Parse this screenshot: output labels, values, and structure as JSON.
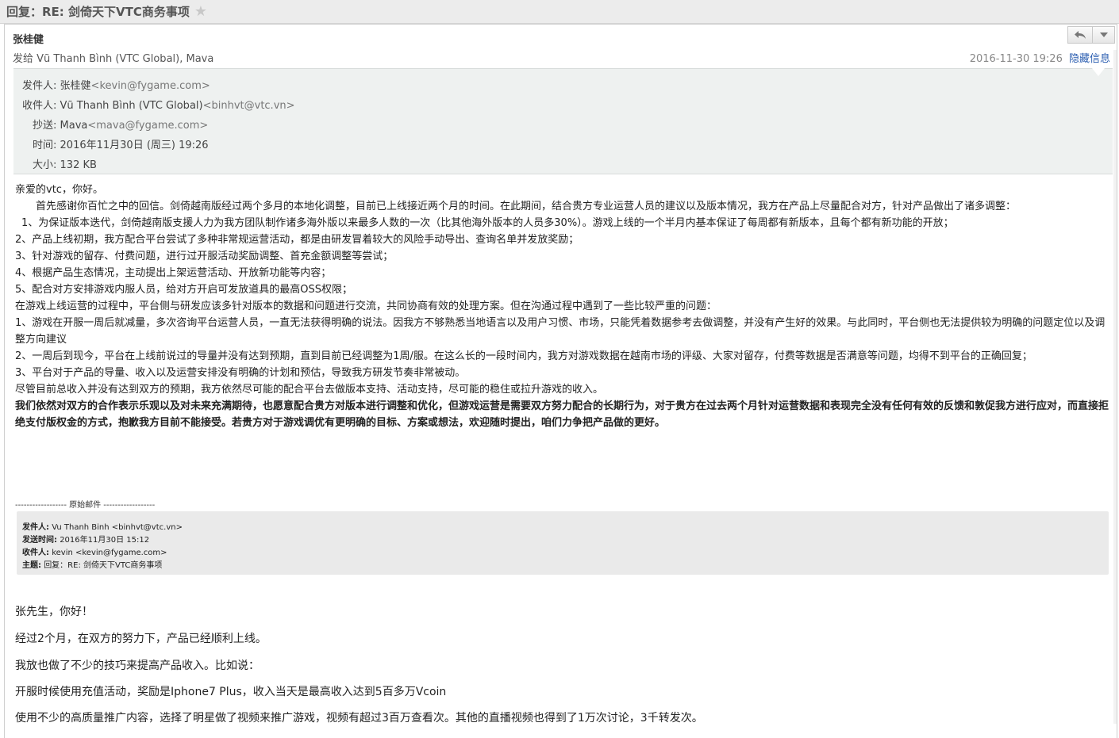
{
  "window": {
    "title": "回复：RE: 剑倚天下VTC商务事项"
  },
  "message": {
    "sender_name": "张桂健",
    "recipients_label": "发给",
    "recipients": "Vũ Thanh Bình (VTC Global), Mava",
    "date": "2016-11-30 19:26",
    "hide_info_label": "隐藏信息"
  },
  "header_details": {
    "from_label": "发件人:",
    "from_name": "张桂健",
    "from_addr": "<kevin@fygame.com>",
    "to_label": "收件人:",
    "to_name": "Vũ Thanh Bình (VTC Global)",
    "to_addr": "<binhvt@vtc.vn>",
    "cc_label": "抄送:",
    "cc_name": "Mava",
    "cc_addr": "<mava@fygame.com>",
    "time_label": "时间:",
    "time_value": "2016年11月30日 (周三) 19:26",
    "size_label": "大小:",
    "size_value": "132 KB"
  },
  "body": {
    "greeting": "亲爱的vtc，你好。",
    "intro": "首先感谢你百忙之中的回信。剑倚越南版经过两个多月的本地化调整，目前已上线接近两个月的时间。在此期间，结合贵方专业运营人员的建议以及版本情况，我方在产品上尽量配合对方，针对产品做出了诸多调整：",
    "item1": "1、为保证版本迭代，剑倚越南版支援人力为我方团队制作诸多海外版以来最多人数的一次（比其他海外版本的人员多30%）。游戏上线的一个半月内基本保证了每周都有新版本，且每个都有新功能的开放；",
    "item2": "2、产品上线初期，我方配合平台尝试了多种非常规运营活动，都是由研发冒着较大的风险手动导出、查询名单并发放奖励；",
    "item3": "3、针对游戏的留存、付费问题，进行过开服活动奖励调整、首充金额调整等尝试；",
    "item4": "4、根据产品生态情况，主动提出上架运营活动、开放新功能等内容；",
    "item5": "5、配合对方安排游戏内服人员，给对方开启可发放道具的最高OSS权限；",
    "problems_intro": "在游戏上线运营的过程中，平台侧与研发应该多针对版本的数据和问题进行交流，共同协商有效的处理方案。但在沟通过程中遇到了一些比较严重的问题：",
    "problem1": "1、游戏在开服一周后就减量，多次咨询平台运营人员，一直无法获得明确的说法。因我方不够熟悉当地语言以及用户习惯、市场，只能凭着数据参考去做调整，并没有产生好的效果。与此同时，平台侧也无法提供较为明确的问题定位以及调整方向建议",
    "problem2": "2、一周后到现今，平台在上线前说过的导量并没有达到预期，直到目前已经调整为1周/服。在这么长的一段时间内，我方对游戏数据在越南市场的评级、大家对留存，付费等数据是否满意等问题，均得不到平台的正确回复；",
    "problem3": "3、平台对于产品的导量、收入以及运营安排没有明确的计划和预估，导致我方研发节奏非常被动。",
    "closing": "尽管目前总收入并没有达到双方的预期，我方依然尽可能的配合平台去做版本支持、活动支持，尽可能的稳住或拉升游戏的收入。",
    "bold_statement": "我们依然对双方的合作表示乐观以及对未来充满期待，也愿意配合贵方对版本进行调整和优化，但游戏运营是需要双方努力配合的长期行为，对于贵方在过去两个月针对运营数据和表现完全没有任何有效的反馈和敦促我方进行应对，而直接拒绝支付版权金的方式，抱歉我方目前不能接受。若贵方对于游戏调优有更明确的目标、方案或想法，欢迎随时提出，咱们力争把产品做的更好。"
  },
  "original": {
    "separator": "------------------ 原始邮件 ------------------",
    "from_label": "发件人:",
    "from_value": "Vu Thanh Binh <binhvt@vtc.vn>",
    "sent_label": "发送时间:",
    "sent_value": "2016年11月30日 15:12",
    "to_label": "收件人:",
    "to_value": "kevin <kevin@fygame.com>",
    "subject_label": "主题:",
    "subject_value": "回复：RE: 剑倚天下VTC商务事项",
    "line1": "张先生，你好！",
    "line2": "经过2个月，在双方的努力下，产品已经顺利上线。",
    "line3": "我放也做了不少的技巧来提高产品收入。比如说：",
    "line4": "开服时候使用充值活动，奖励是Iphone7 Plus，收入当天是最高收入达到5百多万Vcoin",
    "line5": "使用不少的高质量推广内容，选择了明星做了视频来推广游戏，视频有超过3百万查看次。其他的直播视频也得到了1万次讨论，3千转发次。"
  },
  "icons": {
    "star": "star-icon",
    "reply": "reply-icon",
    "dropdown": "chevron-down-icon"
  }
}
